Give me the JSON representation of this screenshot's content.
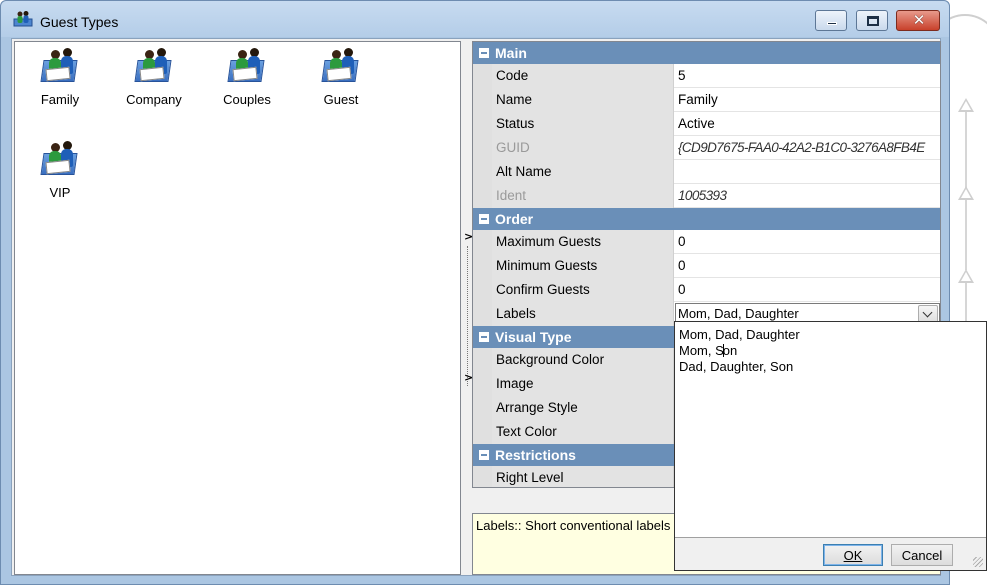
{
  "window": {
    "title": "Guest Types"
  },
  "guest_types": [
    {
      "label": "Family"
    },
    {
      "label": "Company"
    },
    {
      "label": "Couples"
    },
    {
      "label": "Guest"
    },
    {
      "label": "VIP"
    }
  ],
  "splitter": {
    "arrow": ">"
  },
  "property_grid": {
    "categories": {
      "main": "Main",
      "order": "Order",
      "visual_type": "Visual Type",
      "restrictions": "Restrictions"
    },
    "main": {
      "code": {
        "name": "Code",
        "value": "5"
      },
      "name": {
        "name": "Name",
        "value": "Family"
      },
      "status": {
        "name": "Status",
        "value": "Active"
      },
      "guid": {
        "name": "GUID",
        "value": "{CD9D7675-FAA0-42A2-B1C0-3276A8FB4E"
      },
      "alt_name": {
        "name": "Alt Name",
        "value": ""
      },
      "ident": {
        "name": "Ident",
        "value": "1005393"
      }
    },
    "order": {
      "max_guests": {
        "name": "Maximum Guests",
        "value": "0"
      },
      "min_guests": {
        "name": "Minimum Guests",
        "value": "0"
      },
      "confirm_guests": {
        "name": "Confirm Guests",
        "value": "0"
      },
      "labels": {
        "name": "Labels",
        "value": "Mom, Dad, Daughter"
      }
    },
    "visual_type": {
      "background_color": {
        "name": "Background Color"
      },
      "image": {
        "name": "Image"
      },
      "arrange_style": {
        "name": "Arrange Style"
      },
      "text_color": {
        "name": "Text Color"
      }
    },
    "restrictions": {
      "right_level": {
        "name": "Right Level"
      }
    }
  },
  "description": {
    "text": "Labels:: Short conventional labels"
  },
  "dropdown": {
    "lines": [
      "Mom, Dad, Daughter",
      "Mom, S",
      "on",
      "Dad, Daughter, Son"
    ],
    "ok_label": "OK",
    "cancel_label": "Cancel"
  }
}
